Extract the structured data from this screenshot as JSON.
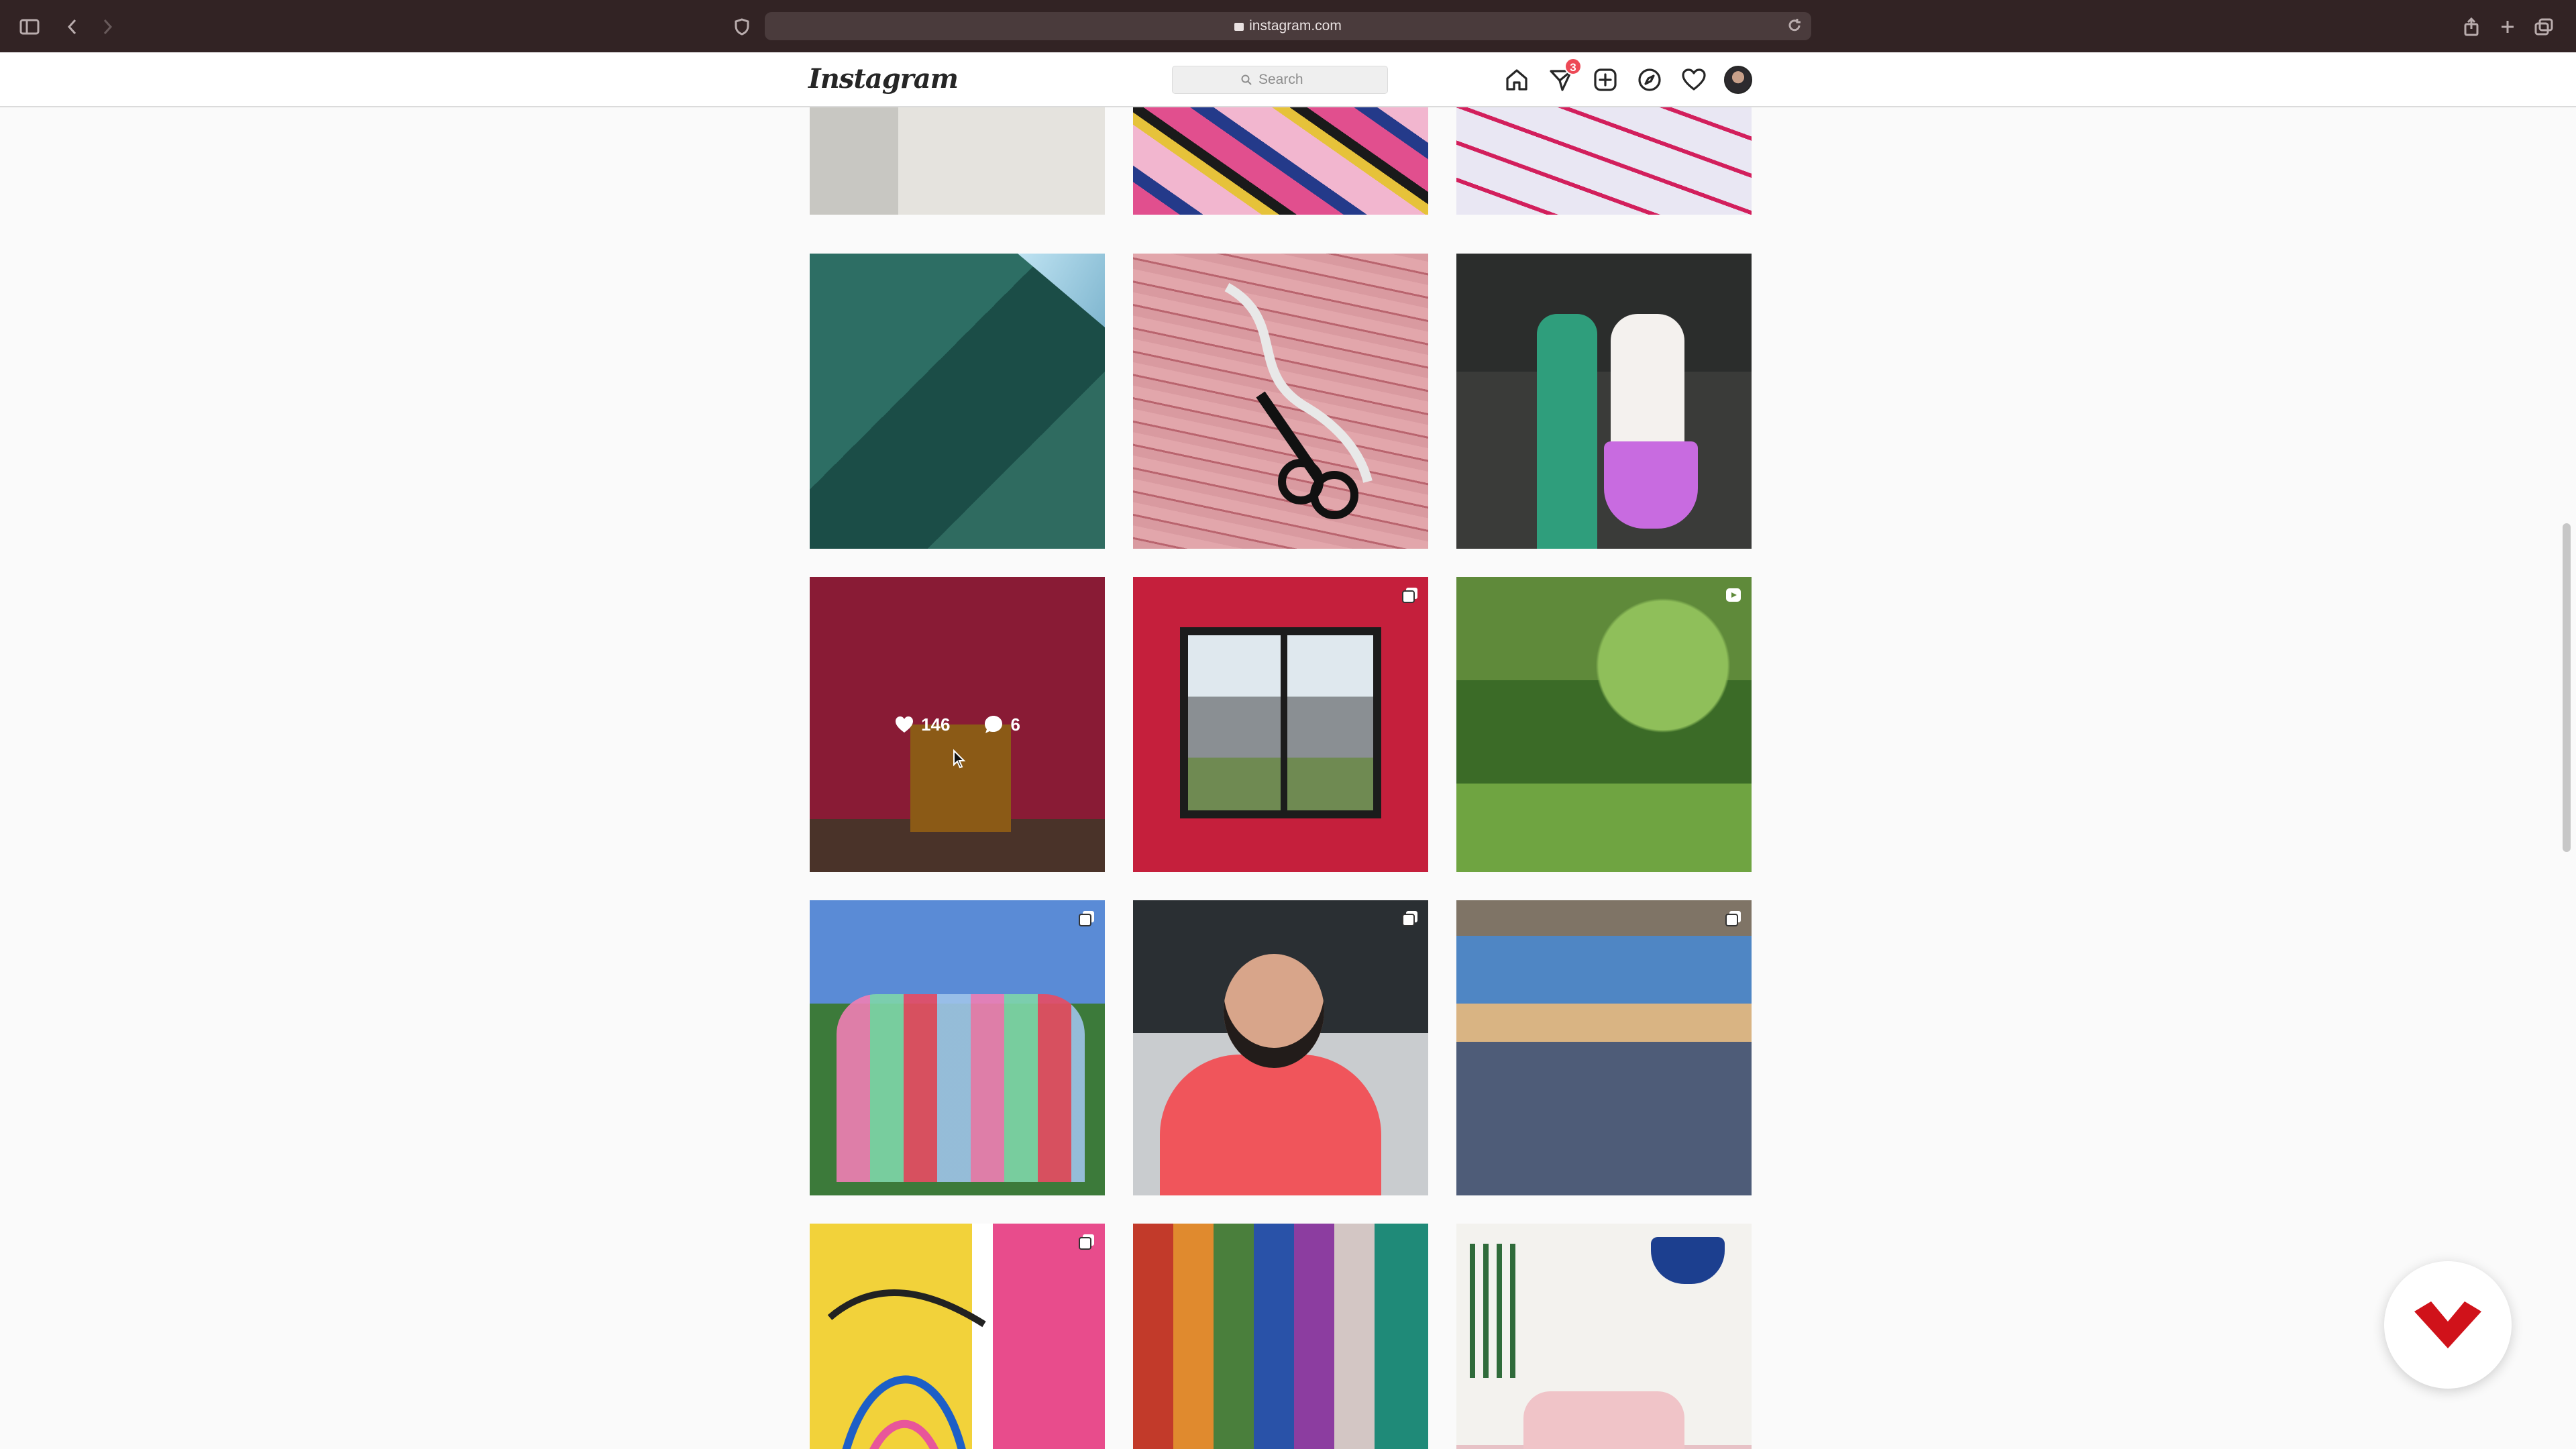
{
  "browser": {
    "url": "instagram.com"
  },
  "nav": {
    "logo": "Instagram",
    "search_placeholder": "Search",
    "direct_badge": "3",
    "icons": [
      "home-icon",
      "direct-icon",
      "new-post-icon",
      "explore-icon",
      "activity-heart-icon",
      "profile-avatar"
    ]
  },
  "grid": {
    "posts": [
      {
        "kind": "photo"
      },
      {
        "kind": "photo"
      },
      {
        "kind": "photo"
      },
      {
        "kind": "photo"
      },
      {
        "kind": "photo"
      },
      {
        "kind": "photo"
      },
      {
        "kind": "photo",
        "hover": true,
        "likes": "146",
        "comments": "6"
      },
      {
        "kind": "carousel"
      },
      {
        "kind": "reel"
      },
      {
        "kind": "carousel"
      },
      {
        "kind": "carousel"
      },
      {
        "kind": "carousel"
      },
      {
        "kind": "carousel"
      },
      {
        "kind": "photo"
      },
      {
        "kind": "photo"
      }
    ]
  },
  "colors": {
    "chrome_bg": "#322324",
    "badge_red": "#ed4956",
    "page_bg": "#fafafa"
  }
}
